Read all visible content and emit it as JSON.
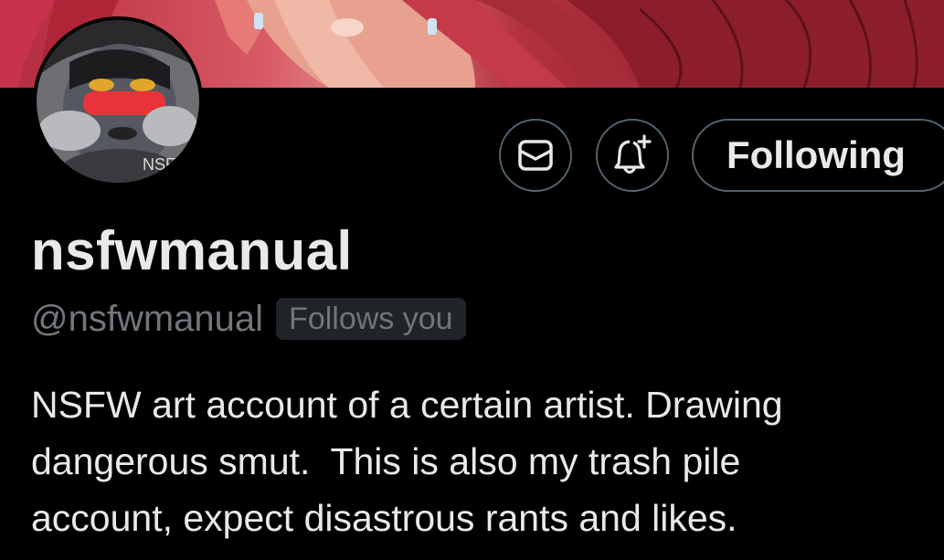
{
  "profile": {
    "display_name": "nsfwmanual",
    "handle": "@nsfwmanual",
    "follows_you_badge": "Follows you",
    "bio": "NSFW art account of a certain artist. Drawing\ndangerous smut.  This is also my trash pile\naccount, expect disastrous rants and likes.",
    "avatar_watermark": "NSF"
  },
  "actions": {
    "message_icon": "envelope-icon",
    "notify_icon": "bell-plus-icon",
    "following_label": "Following"
  },
  "colors": {
    "background": "#000000",
    "text_primary": "#e7e9ea",
    "text_secondary": "#71767b",
    "border": "#536471",
    "badge_bg": "#202327"
  }
}
